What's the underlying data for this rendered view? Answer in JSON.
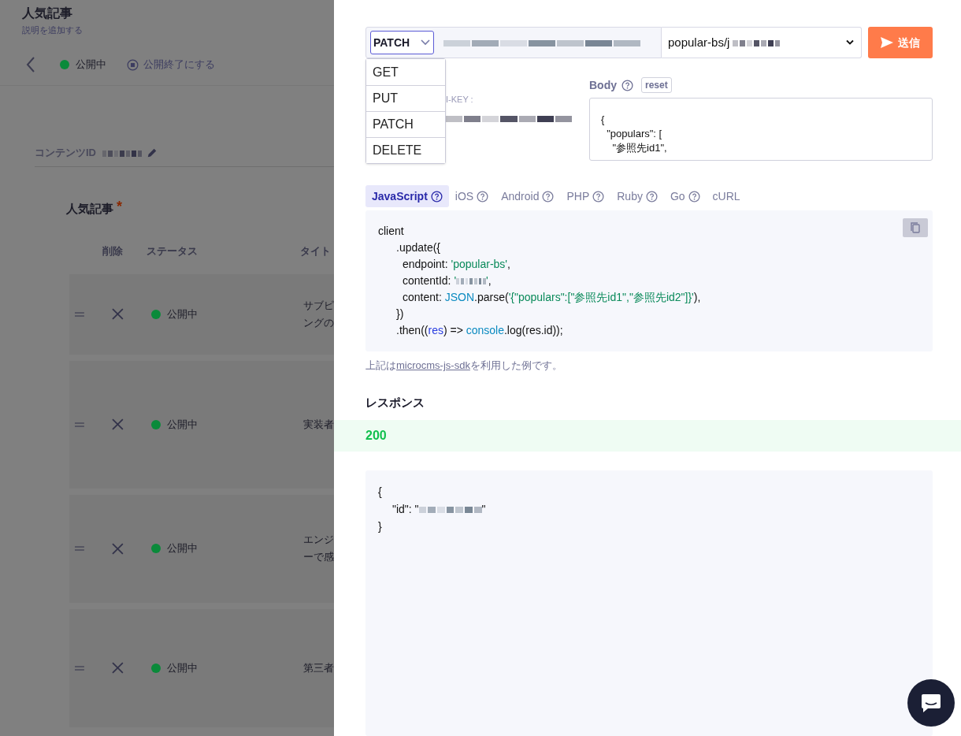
{
  "page": {
    "title": "人気記事",
    "subtitle": "説明を追加する",
    "status": {
      "label": "公開中",
      "color": "#0a8a3a"
    },
    "unpublish_button": "公開終了にする",
    "content_id_label": "コンテンツID",
    "field_label": "人気記事",
    "required_mark": "*",
    "table": {
      "columns": [
        "削除",
        "ステータス",
        "タイト"
      ],
      "rows": [
        {
          "status": "公開中",
          "color": "#0a8a3a",
          "title_lines": [
            "サブピ",
            "ングの"
          ]
        },
        {
          "status": "公開中",
          "color": "#0a8a3a",
          "title_lines": [
            "実装者"
          ]
        },
        {
          "status": "公開中",
          "color": "#0a8a3a",
          "title_lines": [
            "エンジ",
            "ーで感"
          ]
        },
        {
          "status": "公開中",
          "color": "#0a8a3a",
          "title_lines": [
            "第三者"
          ]
        }
      ]
    }
  },
  "panel": {
    "method": "PATCH",
    "methods": [
      {
        "label": "GET",
        "selected": false
      },
      {
        "label": "PUT",
        "selected": false
      },
      {
        "label": "PATCH",
        "selected": false
      },
      {
        "label": "DELETE",
        "selected": false
      }
    ],
    "endpoint": "popular-bs/j",
    "send_button": "送信",
    "api_key_label": "I-KEY :",
    "body_label": "Body",
    "reset_button": "reset",
    "body_lines": [
      "{",
      "  \"populars\": [",
      "    \"参照先id1\","
    ],
    "tabs": [
      {
        "label": "JavaScript",
        "help": true,
        "selected": true
      },
      {
        "label": "iOS",
        "help": true,
        "selected": false
      },
      {
        "label": "Android",
        "help": true,
        "selected": false
      },
      {
        "label": "PHP",
        "help": true,
        "selected": false
      },
      {
        "label": "Ruby",
        "help": true,
        "selected": false
      },
      {
        "label": "Go",
        "help": true,
        "selected": false
      },
      {
        "label": "cURL",
        "help": false,
        "selected": false
      }
    ],
    "code": [
      {
        "tokens": [
          {
            "kind": "plain",
            "text": "client"
          }
        ],
        "children": [
          {
            "tokens": [
              {
                "kind": "plain",
                "text": ".update({"
              }
            ],
            "children": [
              {
                "tokens": [
                  {
                    "kind": "plain",
                    "text": "endpoint: "
                  },
                  {
                    "kind": "string",
                    "text": "'popular-bs'"
                  },
                  {
                    "kind": "plain",
                    "text": ","
                  }
                ]
              },
              {
                "tokens": [
                  {
                    "kind": "plain",
                    "text": "contentId: "
                  },
                  {
                    "kind": "string",
                    "text": "'"
                  },
                  {
                    "kind": "redacted"
                  },
                  {
                    "kind": "string",
                    "text": "'"
                  },
                  {
                    "kind": "plain",
                    "text": ","
                  }
                ]
              },
              {
                "tokens": [
                  {
                    "kind": "plain",
                    "text": "content: "
                  },
                  {
                    "kind": "builtin",
                    "text": "JSON"
                  },
                  {
                    "kind": "plain",
                    "text": ".parse("
                  },
                  {
                    "kind": "string",
                    "text": "'{\"populars\":[\"参照先id1\",\"参照先id2\"]}'"
                  },
                  {
                    "kind": "plain",
                    "text": "),"
                  }
                ]
              }
            ]
          },
          {
            "tokens": [
              {
                "kind": "plain",
                "text": "})"
              }
            ]
          },
          {
            "tokens": [
              {
                "kind": "plain",
                "text": ".then(("
              },
              {
                "kind": "param",
                "text": "res"
              },
              {
                "kind": "plain",
                "text": ") => "
              },
              {
                "kind": "builtin",
                "text": "console"
              },
              {
                "kind": "plain",
                "text": ".log(res.id));"
              }
            ]
          }
        ]
      }
    ],
    "note_before": "上記は",
    "note_link": "microcms-js-sdk",
    "note_after": "を利用した例です。",
    "response_heading": "レスポンス",
    "response_status": "200",
    "response": [
      {
        "tokens": [
          {
            "kind": "plain",
            "text": "{"
          }
        ],
        "children": [
          {
            "tokens": [
              {
                "kind": "plain",
                "text": "\"id\": \""
              },
              {
                "kind": "redacted"
              },
              {
                "kind": "plain",
                "text": "\""
              }
            ]
          }
        ]
      },
      {
        "tokens": [
          {
            "kind": "plain",
            "text": "}"
          }
        ]
      }
    ]
  }
}
